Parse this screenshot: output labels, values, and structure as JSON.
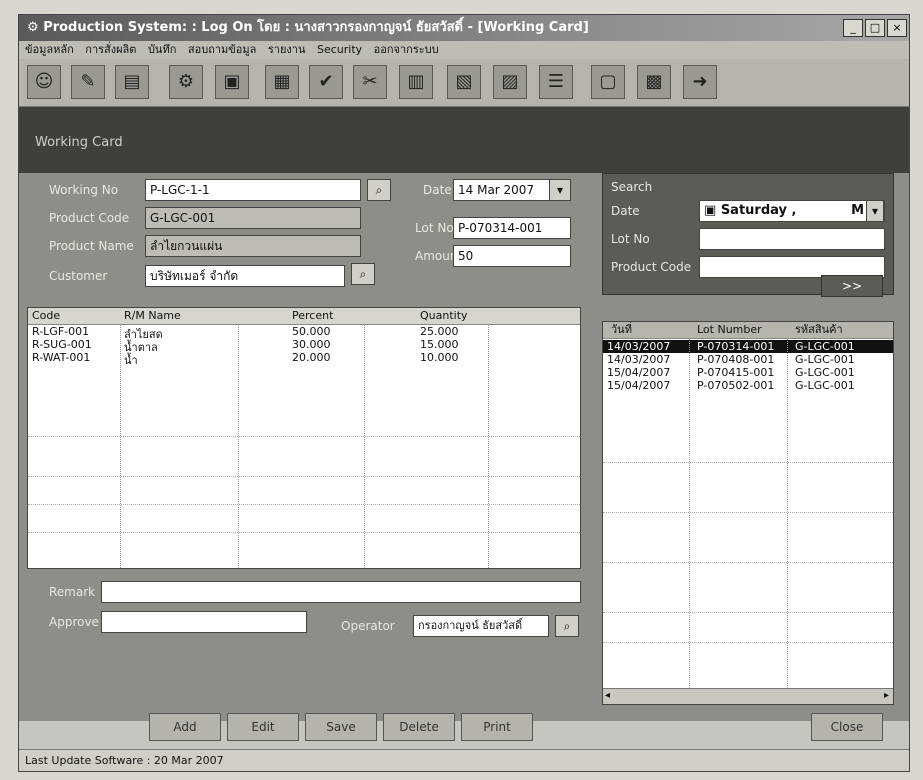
{
  "window": {
    "title": "Production System: : Log On โดย :  นางสาวกรองกาญจน์ ธัยสวัสดิ์ - [Working Card]",
    "controls": [
      "_",
      "□",
      "×"
    ]
  },
  "menu": [
    "ข้อมูลหลัก",
    "การสั่งผลิต",
    "บันทึก",
    "สอบถามข้อมูล",
    "รายงาน",
    "Security",
    "ออกจากระบบ"
  ],
  "toolbar_icons": [
    "person-icon",
    "tool-icon",
    "chart-icon",
    "gear-icon",
    "card-icon",
    "report-icon",
    "check-icon",
    "wrench-icon",
    "calc-icon",
    "folder-icon",
    "sheet-icon",
    "list-icon",
    "doc-icon",
    "grid-icon",
    "exit-icon"
  ],
  "form_title": "Working Card",
  "form": {
    "working_no_label": "Working No",
    "working_no": "P-LGC-1-1",
    "date_label": "Date",
    "date": "14 Mar 2007",
    "product_code_label": "Product Code",
    "product_code": "G-LGC-001",
    "lot_no_label": "Lot No",
    "lot_no": "P-070314-001",
    "product_name_label": "Product Name",
    "product_name": "ลำไยกวนแผ่น",
    "amount_label": "Amount",
    "amount": "50",
    "customer_label": "Customer",
    "customer": "บริษัทเมอร์ จำกัด"
  },
  "search": {
    "label": "Search",
    "date_label": "Date",
    "date": "Saturday ,",
    "date_suffix": "M",
    "lot_label": "Lot No",
    "lot": "",
    "product_label": "Product Code",
    "product": "",
    "find_label": ">>"
  },
  "materials": {
    "columns": [
      "Code",
      "R/M Name",
      "Percent",
      "Quantity"
    ],
    "rows": [
      {
        "code": "R-LGF-001",
        "name": "ลำไยสด",
        "percent": "50.000",
        "quantity": "25.000"
      },
      {
        "code": "R-SUG-001",
        "name": "น้ำตาล",
        "percent": "30.000",
        "quantity": "15.000"
      },
      {
        "code": "R-WAT-001",
        "name": "น้ำ",
        "percent": "20.000",
        "quantity": "10.000"
      }
    ]
  },
  "history": {
    "columns": [
      "วันที่",
      "Lot Number",
      "รหัสสินค้า"
    ],
    "rows": [
      {
        "date": "14/03/2007",
        "lot": "P-070314-001",
        "code": "G-LGC-001",
        "selected": true
      },
      {
        "date": "14/03/2007",
        "lot": "P-070408-001",
        "code": "G-LGC-001",
        "selected": false
      },
      {
        "date": "15/04/2007",
        "lot": "P-070415-001",
        "code": "G-LGC-001",
        "selected": false
      },
      {
        "date": "15/04/2007",
        "lot": "P-070502-001",
        "code": "G-LGC-001",
        "selected": false
      }
    ]
  },
  "bottom": {
    "remark_label": "Remark",
    "remark": "",
    "approve_label": "Approve",
    "approve": "",
    "operator_label": "Operator",
    "operator": "กรองกาญจน์ ธัยสวัสดิ์"
  },
  "buttons": [
    "Add",
    "Edit",
    "Save",
    "Delete",
    "Print",
    "Close"
  ],
  "status": "Last Update Software : 20 Mar 2007"
}
